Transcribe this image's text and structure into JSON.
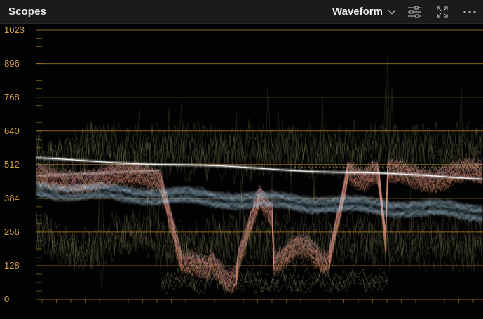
{
  "titlebar": {
    "title": "Scopes",
    "mode": "Waveform",
    "icons": {
      "mode_dropdown": "chevron-down-icon",
      "settings": "sliders-icon",
      "expand": "expand-icon",
      "more": "more-horizontal-icon"
    }
  },
  "scope": {
    "type": "waveform",
    "scale_min": 0,
    "scale_max": 1023,
    "scale_labels": [
      "1023",
      "896",
      "768",
      "640",
      "512",
      "384",
      "256",
      "128",
      "0"
    ],
    "colors": {
      "graticule": "#b8861f",
      "label": "#d9a440",
      "trace_warm": "#e8a070",
      "trace_cool": "#a9d4f0",
      "trace_white": "#ffffff"
    }
  }
}
